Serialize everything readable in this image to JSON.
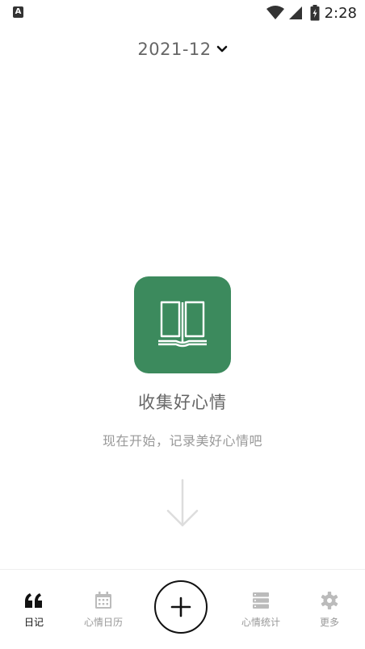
{
  "status_bar": {
    "app_icon_letter": "A",
    "time": "2:28"
  },
  "header": {
    "month": "2021-12"
  },
  "empty_state": {
    "title": "收集好心情",
    "subtitle": "现在开始，记录美好心情吧"
  },
  "bottom_nav": {
    "items": [
      {
        "label": "日记",
        "icon": "quote-icon",
        "active": true
      },
      {
        "label": "心情日历",
        "icon": "calendar-icon",
        "active": false
      },
      {
        "label": "心情统计",
        "icon": "stats-list-icon",
        "active": false
      },
      {
        "label": "更多",
        "icon": "gear-icon",
        "active": false
      }
    ],
    "add_icon": "plus-icon"
  },
  "colors": {
    "accent_green": "#3c8a5d",
    "active_text": "#111111",
    "inactive_text": "#999999"
  }
}
